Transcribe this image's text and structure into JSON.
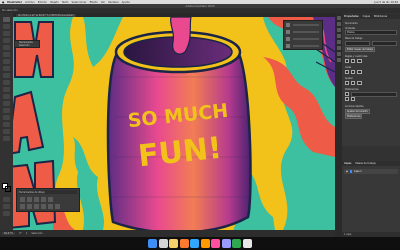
{
  "menubar": {
    "apple_icon": "apple-logo",
    "app_name": "Illustrator",
    "items": [
      "Archivo",
      "Edición",
      "Objeto",
      "Texto",
      "Seleccionar",
      "Efecto",
      "Ver",
      "Ventana",
      "Ayuda"
    ],
    "clock": "Jue 5 de dic 10:44"
  },
  "window": {
    "title": "Adobe Illustrator 2020"
  },
  "control_bar": {
    "selection_label": "Sin selección"
  },
  "document": {
    "tab_label": "Sin título-1.ai* al 66,67 % (CMYK/Previsualizar)"
  },
  "canvas": {
    "headline_line1": "SO MUCH",
    "headline_line2": "FUN!",
    "colors": {
      "yellow": "#f2c21b",
      "teal": "#3cc0a0",
      "coral": "#ee5b47",
      "purple": "#5c2d84",
      "pink": "#e94a8f",
      "navy": "#1b2548"
    }
  },
  "toolbar": {
    "flyout_top": {
      "label": "Herramienta Selección"
    },
    "flyout_bottom": {
      "label": "Herramientas de dibujo"
    }
  },
  "properties_panel": {
    "tabs": [
      "Propiedades",
      "Capas",
      "Bibliotecas"
    ],
    "section_doc": "Documento",
    "units_label": "Unidades",
    "units_value": "Píxeles",
    "artboard_label": "Mesa de trabajo",
    "edit_artboards_button": "Editar mesas de trabajo",
    "rulers_label": "Reglas y cuadrículas",
    "guides_label": "Guías",
    "snap_label": "Ajustar",
    "preferences_label": "Preferencias",
    "quick_actions_label": "Acciones rápidas",
    "doc_setup_button": "Ajustar documento",
    "preferences_button": "Preferencias"
  },
  "layers_panel": {
    "tabs": [
      "Capas",
      "Mesas de trabajo"
    ],
    "layers": [
      "Capa 1"
    ],
    "footer": "1 capa"
  },
  "status_bar": {
    "zoom": "66,67%",
    "rotation": "0°",
    "artboard": "1",
    "tool": "Selección"
  },
  "dock_colors": [
    "#3e8ef7",
    "#d6d6d6",
    "#f5d06b",
    "#ff7a2f",
    "#31a8ff",
    "#ff9a00",
    "#ff4fa0",
    "#9999ff",
    "#2fa84f",
    "#e8e8e8"
  ]
}
